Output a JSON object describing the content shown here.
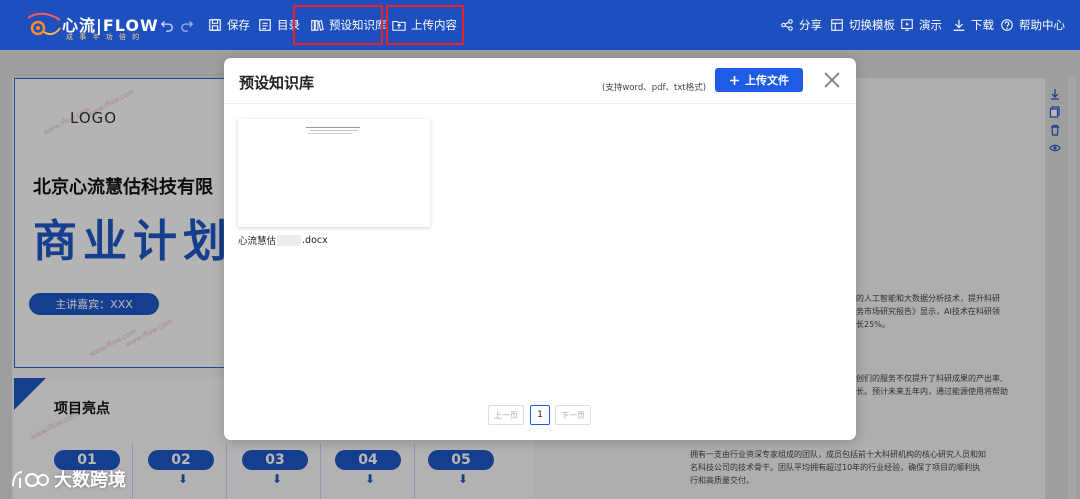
{
  "toolbar": {
    "logo_text": "心流|FLOW",
    "logo_sub": "成 事 半 功 倍 的",
    "save": "保存",
    "toc": "目录",
    "preset_kb": "预设知识库",
    "upload_content": "上传内容",
    "share": "分享",
    "switch_template": "切换模板",
    "present": "演示",
    "download": "下载",
    "help": "帮助中心"
  },
  "slide": {
    "logo": "LOGO",
    "company": "北京心流慧估科技有限",
    "title": "商业计划",
    "speaker": "主讲嘉宾：XXX",
    "watermark": "www.iflow.com",
    "highlights_title": "项目亮点",
    "numbers": [
      "01",
      "02",
      "03",
      "04",
      "05"
    ],
    "right_lines": [
      "的人工智能和大数据分析技术，提升科研",
      "务市场研究报告》显示，AI技术在科研领",
      "长25%。",
      "创们的服务不仅提升了科研成果的产出率,",
      "长。预计未来五年内，通过能源使用将帮助",
      "拥有一支由行业资深专家组成的团队，成员包括前十大科研机构的核心研究人员和知",
      "名科技公司的技术骨干。团队平均拥有超过10年的行业经验，确保了项目的顺利执",
      "行和高质量交付。"
    ]
  },
  "brand_watermark": "大数跨境",
  "modal": {
    "title": "预设知识库",
    "formats_hint": "(支持word、pdf、txt格式)",
    "upload_button": "上传文件",
    "file": {
      "name_prefix": "心流慧估",
      "name_suffix": ".docx"
    },
    "pagination": {
      "prev": "上一页",
      "current": "1",
      "next": "下一页"
    }
  },
  "colors": {
    "toolbar_bg": "#1d4fbf",
    "accent": "#1f5ce6",
    "highlight_border": "#e8232a"
  }
}
